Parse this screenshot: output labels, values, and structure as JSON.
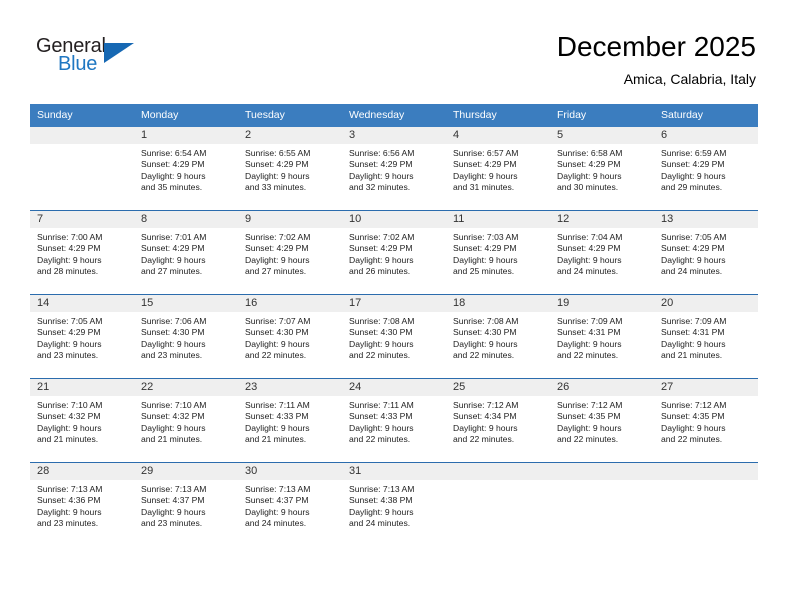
{
  "brand": {
    "name_top": "General",
    "name_bottom": "Blue",
    "accent_color": "#1668b3",
    "text_color": "#231f20"
  },
  "header": {
    "title": "December 2025",
    "subtitle": "Amica, Calabria, Italy"
  },
  "theme": {
    "header_row_bg": "#3b7dbf",
    "row_divider": "#2b6cad",
    "daynum_band_bg": "#efefef",
    "page_bg": "#ffffff"
  },
  "calendar": {
    "weekday_headers": [
      "Sunday",
      "Monday",
      "Tuesday",
      "Wednesday",
      "Thursday",
      "Friday",
      "Saturday"
    ],
    "weeks": [
      [
        {
          "day": "",
          "info": "",
          "empty": true
        },
        {
          "day": "1",
          "info": "Sunrise: 6:54 AM\nSunset: 4:29 PM\nDaylight: 9 hours\nand 35 minutes."
        },
        {
          "day": "2",
          "info": "Sunrise: 6:55 AM\nSunset: 4:29 PM\nDaylight: 9 hours\nand 33 minutes."
        },
        {
          "day": "3",
          "info": "Sunrise: 6:56 AM\nSunset: 4:29 PM\nDaylight: 9 hours\nand 32 minutes."
        },
        {
          "day": "4",
          "info": "Sunrise: 6:57 AM\nSunset: 4:29 PM\nDaylight: 9 hours\nand 31 minutes."
        },
        {
          "day": "5",
          "info": "Sunrise: 6:58 AM\nSunset: 4:29 PM\nDaylight: 9 hours\nand 30 minutes."
        },
        {
          "day": "6",
          "info": "Sunrise: 6:59 AM\nSunset: 4:29 PM\nDaylight: 9 hours\nand 29 minutes."
        }
      ],
      [
        {
          "day": "7",
          "info": "Sunrise: 7:00 AM\nSunset: 4:29 PM\nDaylight: 9 hours\nand 28 minutes."
        },
        {
          "day": "8",
          "info": "Sunrise: 7:01 AM\nSunset: 4:29 PM\nDaylight: 9 hours\nand 27 minutes."
        },
        {
          "day": "9",
          "info": "Sunrise: 7:02 AM\nSunset: 4:29 PM\nDaylight: 9 hours\nand 27 minutes."
        },
        {
          "day": "10",
          "info": "Sunrise: 7:02 AM\nSunset: 4:29 PM\nDaylight: 9 hours\nand 26 minutes."
        },
        {
          "day": "11",
          "info": "Sunrise: 7:03 AM\nSunset: 4:29 PM\nDaylight: 9 hours\nand 25 minutes."
        },
        {
          "day": "12",
          "info": "Sunrise: 7:04 AM\nSunset: 4:29 PM\nDaylight: 9 hours\nand 24 minutes."
        },
        {
          "day": "13",
          "info": "Sunrise: 7:05 AM\nSunset: 4:29 PM\nDaylight: 9 hours\nand 24 minutes."
        }
      ],
      [
        {
          "day": "14",
          "info": "Sunrise: 7:05 AM\nSunset: 4:29 PM\nDaylight: 9 hours\nand 23 minutes."
        },
        {
          "day": "15",
          "info": "Sunrise: 7:06 AM\nSunset: 4:30 PM\nDaylight: 9 hours\nand 23 minutes."
        },
        {
          "day": "16",
          "info": "Sunrise: 7:07 AM\nSunset: 4:30 PM\nDaylight: 9 hours\nand 22 minutes."
        },
        {
          "day": "17",
          "info": "Sunrise: 7:08 AM\nSunset: 4:30 PM\nDaylight: 9 hours\nand 22 minutes."
        },
        {
          "day": "18",
          "info": "Sunrise: 7:08 AM\nSunset: 4:30 PM\nDaylight: 9 hours\nand 22 minutes."
        },
        {
          "day": "19",
          "info": "Sunrise: 7:09 AM\nSunset: 4:31 PM\nDaylight: 9 hours\nand 22 minutes."
        },
        {
          "day": "20",
          "info": "Sunrise: 7:09 AM\nSunset: 4:31 PM\nDaylight: 9 hours\nand 21 minutes."
        }
      ],
      [
        {
          "day": "21",
          "info": "Sunrise: 7:10 AM\nSunset: 4:32 PM\nDaylight: 9 hours\nand 21 minutes."
        },
        {
          "day": "22",
          "info": "Sunrise: 7:10 AM\nSunset: 4:32 PM\nDaylight: 9 hours\nand 21 minutes."
        },
        {
          "day": "23",
          "info": "Sunrise: 7:11 AM\nSunset: 4:33 PM\nDaylight: 9 hours\nand 21 minutes."
        },
        {
          "day": "24",
          "info": "Sunrise: 7:11 AM\nSunset: 4:33 PM\nDaylight: 9 hours\nand 22 minutes."
        },
        {
          "day": "25",
          "info": "Sunrise: 7:12 AM\nSunset: 4:34 PM\nDaylight: 9 hours\nand 22 minutes."
        },
        {
          "day": "26",
          "info": "Sunrise: 7:12 AM\nSunset: 4:35 PM\nDaylight: 9 hours\nand 22 minutes."
        },
        {
          "day": "27",
          "info": "Sunrise: 7:12 AM\nSunset: 4:35 PM\nDaylight: 9 hours\nand 22 minutes."
        }
      ],
      [
        {
          "day": "28",
          "info": "Sunrise: 7:13 AM\nSunset: 4:36 PM\nDaylight: 9 hours\nand 23 minutes."
        },
        {
          "day": "29",
          "info": "Sunrise: 7:13 AM\nSunset: 4:37 PM\nDaylight: 9 hours\nand 23 minutes."
        },
        {
          "day": "30",
          "info": "Sunrise: 7:13 AM\nSunset: 4:37 PM\nDaylight: 9 hours\nand 24 minutes."
        },
        {
          "day": "31",
          "info": "Sunrise: 7:13 AM\nSunset: 4:38 PM\nDaylight: 9 hours\nand 24 minutes."
        },
        {
          "day": "",
          "info": "",
          "empty": true
        },
        {
          "day": "",
          "info": "",
          "empty": true
        },
        {
          "day": "",
          "info": "",
          "empty": true
        }
      ]
    ]
  }
}
